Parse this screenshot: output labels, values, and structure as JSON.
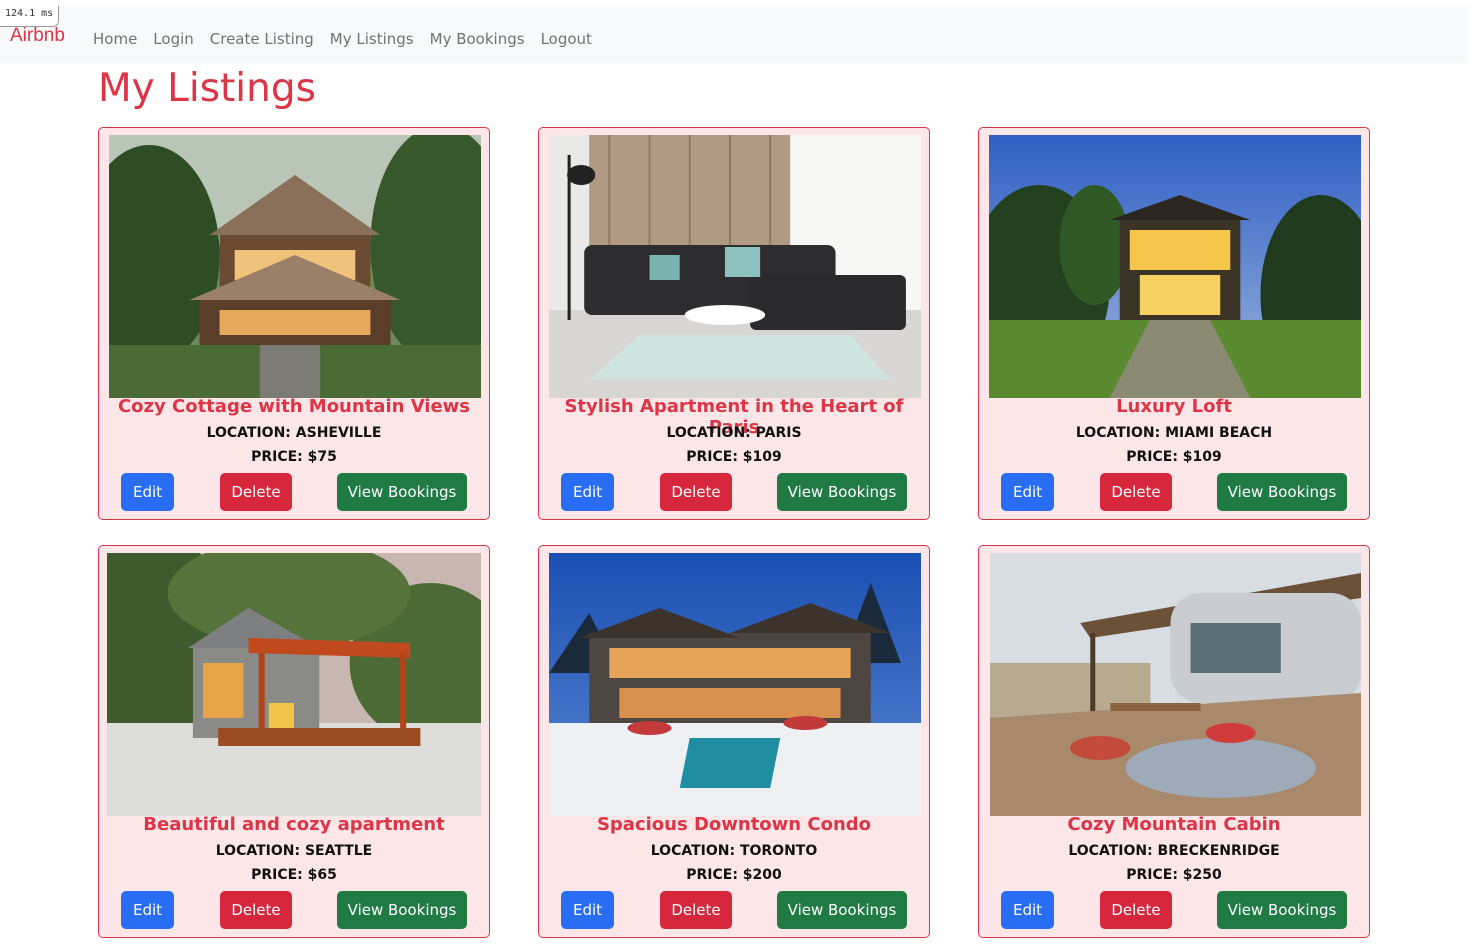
{
  "timer": "124.1 ms",
  "brand": "Airbnb",
  "nav": [
    "Home",
    "Login",
    "Create Listing",
    "My Listings",
    "My Bookings",
    "Logout"
  ],
  "page_title": "My Listings",
  "buttons": {
    "edit": "Edit",
    "delete": "Delete",
    "view": "View Bookings"
  },
  "listings": [
    {
      "title": "Cozy Cottage with Mountain Views",
      "location": "LOCATION: ASHEVILLE",
      "price": "PRICE: $75"
    },
    {
      "title": "Stylish Apartment in the Heart of Paris",
      "location": "LOCATION: PARIS",
      "price": "PRICE: $109"
    },
    {
      "title": "Luxury Loft",
      "location": "LOCATION: MIAMI BEACH",
      "price": "PRICE: $109"
    },
    {
      "title": "Beautiful and cozy apartment",
      "location": "LOCATION: SEATTLE",
      "price": "PRICE: $65"
    },
    {
      "title": "Spacious Downtown Condo",
      "location": "LOCATION: TORONTO",
      "price": "PRICE: $200"
    },
    {
      "title": "Cozy Mountain Cabin",
      "location": "LOCATION: BRECKENRIDGE",
      "price": "PRICE: $250"
    }
  ],
  "colors": {
    "accent": "#dc3545",
    "card_bg": "#fde6e8",
    "edit": "#2a6df5",
    "delete": "#d6273c",
    "view": "#1f7a44"
  }
}
